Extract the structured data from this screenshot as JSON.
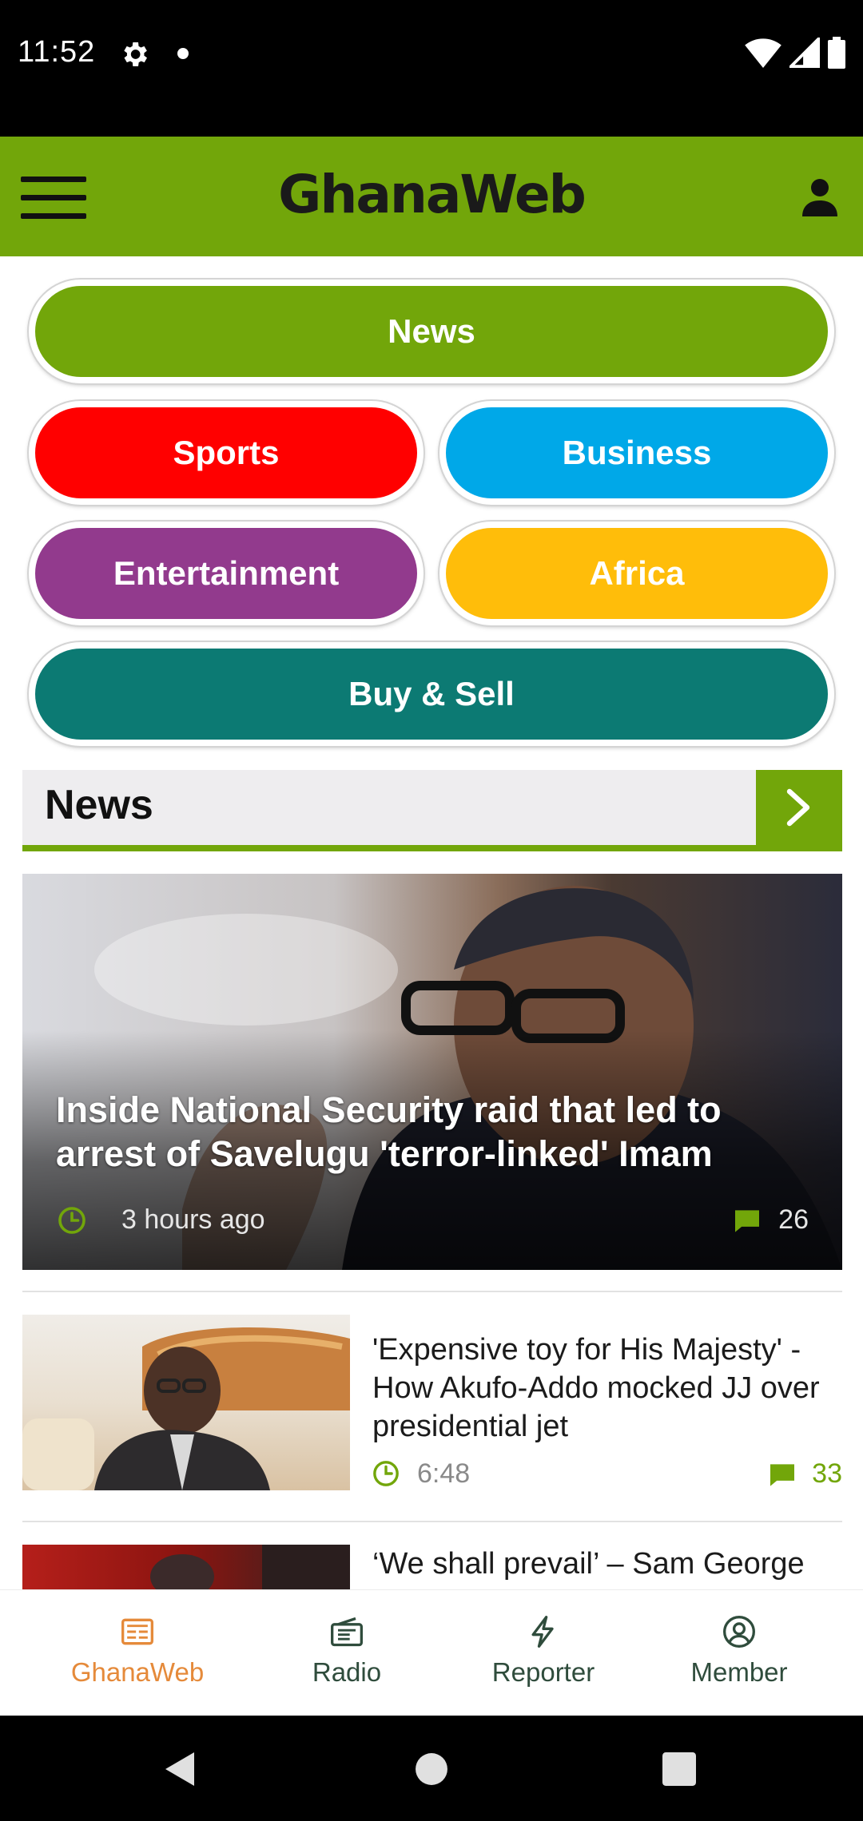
{
  "status_bar": {
    "time": "11:52"
  },
  "app_bar": {
    "title": "GhanaWeb"
  },
  "categories": [
    {
      "label": "News",
      "color": "#72a60a"
    },
    {
      "label": "Sports",
      "color": "#ff0000"
    },
    {
      "label": "Business",
      "color": "#00a8e8"
    },
    {
      "label": "Entertainment",
      "color": "#923a8d"
    },
    {
      "label": "Africa",
      "color": "#ffbd0a"
    },
    {
      "label": "Buy & Sell",
      "color": "#0c7a73"
    }
  ],
  "section": {
    "title": "News"
  },
  "hero": {
    "title": "Inside National Security raid that led to arrest of Savelugu 'terror-linked' Imam",
    "time": "3 hours ago",
    "comments": "26"
  },
  "articles": [
    {
      "title": "'Expensive toy for His Majesty' - How Akufo-Addo mocked JJ over presidential jet",
      "time": "6:48",
      "comments": "33"
    },
    {
      "title": "‘We shall prevail’ – Sam George"
    }
  ],
  "bottom_nav": [
    {
      "label": "GhanaWeb",
      "icon": "newspaper-icon",
      "active": true
    },
    {
      "label": "Radio",
      "icon": "radio-icon",
      "active": false
    },
    {
      "label": "Reporter",
      "icon": "lightning-icon",
      "active": false
    },
    {
      "label": "Member",
      "icon": "user-circle-icon",
      "active": false
    }
  ],
  "colors": {
    "brand_green": "#72a60a",
    "active_nav": "#e58a3a",
    "nav_text": "#2f4c3c"
  }
}
